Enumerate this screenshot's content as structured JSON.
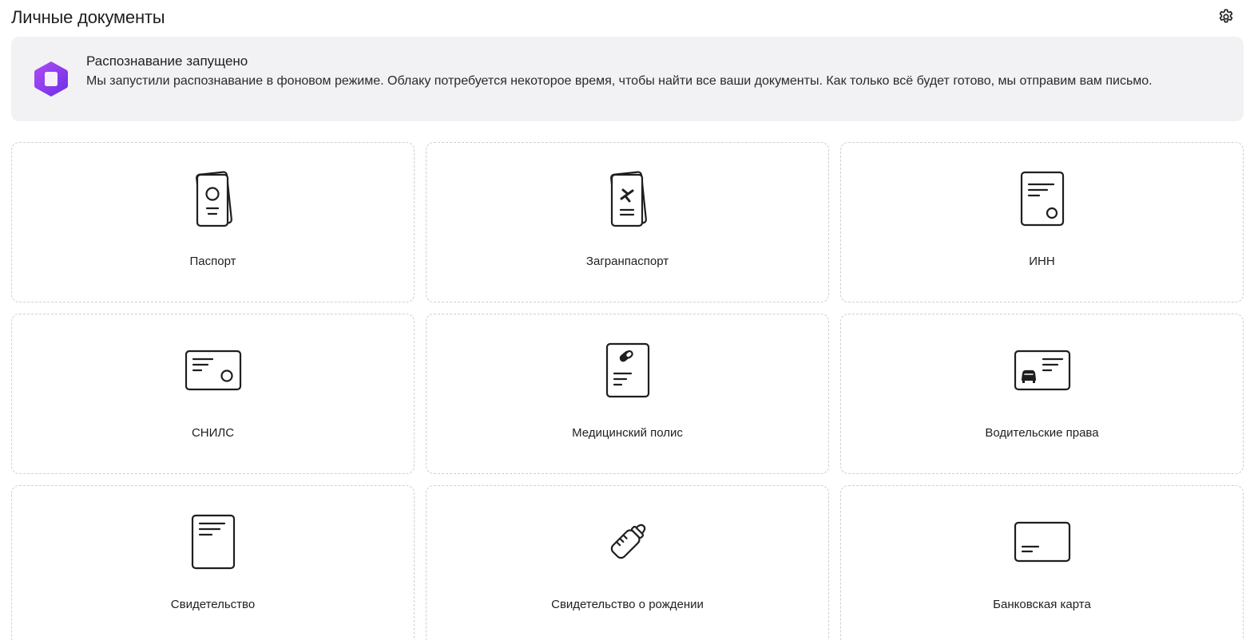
{
  "page": {
    "title": "Личные документы"
  },
  "settings": {
    "icon": "gear-icon"
  },
  "banner": {
    "icon": "recognition-hexagon-icon",
    "title": "Распознавание запущено",
    "text": "Мы запустили распознавание в фоновом режиме. Облаку потребуется некоторое время, чтобы найти все ваши документы. Как только всё будет готово, мы отправим вам письмо.",
    "accent_color": "#8b3df0"
  },
  "documents": [
    {
      "label": "Паспорт",
      "icon": "passport-icon"
    },
    {
      "label": "Загранпаспорт",
      "icon": "international-passport-icon"
    },
    {
      "label": "ИНН",
      "icon": "inn-document-icon"
    },
    {
      "label": "СНИЛС",
      "icon": "snils-card-icon"
    },
    {
      "label": "Медицинский полис",
      "icon": "medical-policy-icon"
    },
    {
      "label": "Водительские права",
      "icon": "driver-license-icon"
    },
    {
      "label": "Свидетельство",
      "icon": "certificate-icon"
    },
    {
      "label": "Свидетельство о рождении",
      "icon": "baby-bottle-icon"
    },
    {
      "label": "Банковская карта",
      "icon": "bank-card-icon"
    }
  ]
}
